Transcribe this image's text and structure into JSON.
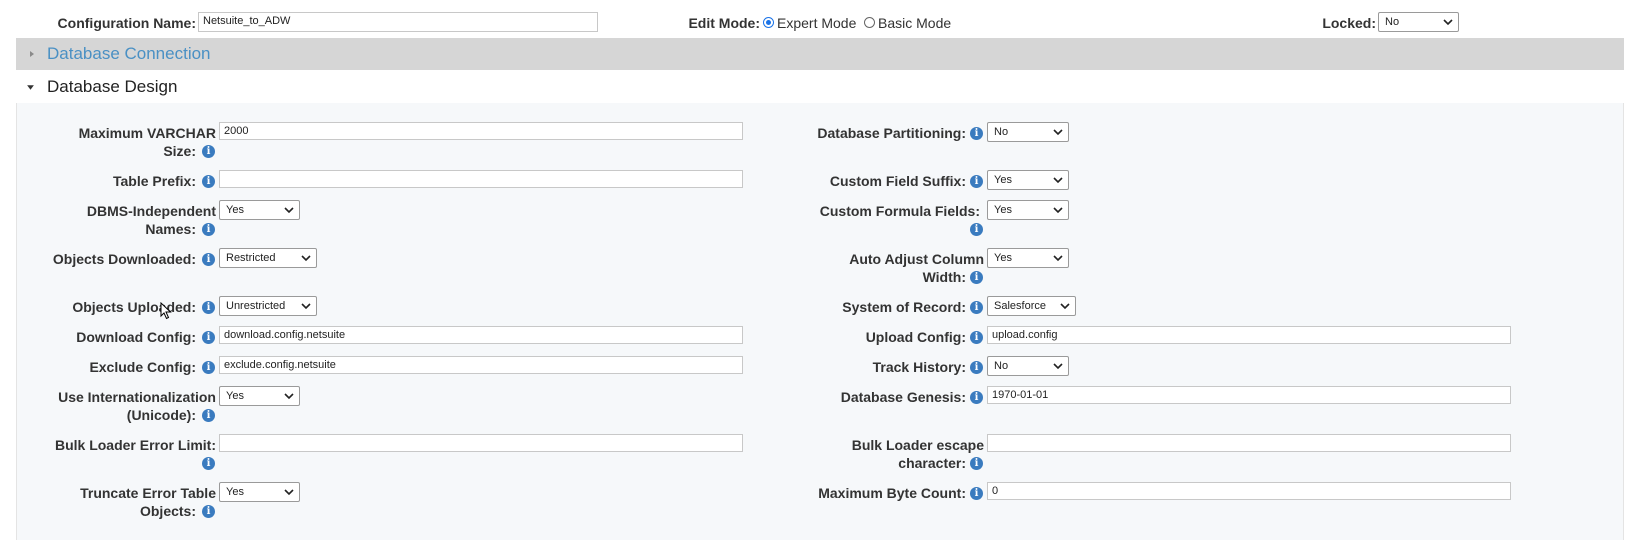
{
  "header": {
    "config_name_label": "Configuration Name:",
    "config_name_value": "Netsuite_to_ADW",
    "edit_mode_label": "Edit Mode:",
    "expert_mode_label": "Expert Mode",
    "basic_mode_label": "Basic Mode",
    "selected_mode": "Expert Mode",
    "locked_label": "Locked:",
    "locked_value": "No"
  },
  "sections": {
    "connection_title": "Database Connection",
    "design_title": "Database Design"
  },
  "left": {
    "max_varchar_label_1": "Maximum VARCHAR",
    "max_varchar_label_2": "Size:",
    "max_varchar_value": "2000",
    "table_prefix_label": "Table Prefix:",
    "table_prefix_value": "",
    "dbms_label_1": "DBMS-Independent",
    "dbms_label_2": "Names:",
    "dbms_value": "Yes",
    "objects_downloaded_label": "Objects Downloaded:",
    "objects_downloaded_value": "Restricted",
    "objects_uploaded_label": "Objects Uploaded:",
    "objects_uploaded_value": "Unrestricted",
    "download_config_label": "Download Config:",
    "download_config_value": "download.config.netsuite",
    "exclude_config_label": "Exclude Config:",
    "exclude_config_value": "exclude.config.netsuite",
    "intl_label_1": "Use Internationalization",
    "intl_label_2": "(Unicode):",
    "intl_value": "Yes",
    "bulk_error_label": "Bulk Loader Error Limit:",
    "bulk_error_value": "",
    "truncate_label_1": "Truncate Error Table",
    "truncate_label_2": "Objects:",
    "truncate_value": "Yes"
  },
  "right": {
    "partitioning_label": "Database Partitioning:",
    "partitioning_value": "No",
    "custom_suffix_label": "Custom Field Suffix:",
    "custom_suffix_value": "Yes",
    "formula_label": "Custom Formula Fields:",
    "formula_value": "Yes",
    "auto_adjust_label_1": "Auto Adjust Column",
    "auto_adjust_label_2": "Width:",
    "auto_adjust_value": "Yes",
    "system_record_label": "System of Record:",
    "system_record_value": "Salesforce",
    "upload_config_label": "Upload Config:",
    "upload_config_value": "upload.config",
    "track_history_label": "Track History:",
    "track_history_value": "No",
    "genesis_label": "Database Genesis:",
    "genesis_value": "1970-01-01",
    "escape_label_1": "Bulk Loader escape",
    "escape_label_2": "character:",
    "escape_value": "",
    "max_byte_label": "Maximum Byte Count:",
    "max_byte_value": "0"
  },
  "icons": {
    "info": "i",
    "collapsed": "caret-right",
    "expanded": "caret-down",
    "dropdown": "chevron-down"
  },
  "colors": {
    "accent_link": "#4a90c4",
    "collapsed_bar": "#d6d6d6",
    "panel_bg": "#f6f8fa",
    "info_icon": "#3a7bbf"
  }
}
